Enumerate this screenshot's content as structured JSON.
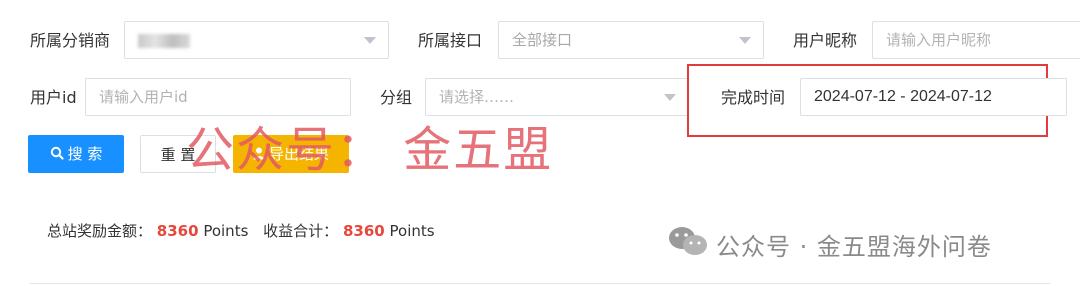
{
  "filters": {
    "distributor": {
      "label": "所属分销商",
      "value": ""
    },
    "interface": {
      "label": "所属接口",
      "value": "全部接口"
    },
    "nickname": {
      "label": "用户昵称",
      "placeholder": "请输入用户昵称"
    },
    "user_id": {
      "label": "用户id",
      "placeholder": "请输入用户id"
    },
    "group": {
      "label": "分组",
      "placeholder": "请选择……"
    },
    "finish_time": {
      "label": "完成时间",
      "value": "2024-07-12 - 2024-07-12"
    }
  },
  "actions": {
    "search": "搜 索",
    "reset": "重 置",
    "export": "导出结果"
  },
  "stats": {
    "total_reward_label": "总站奖励金额：",
    "total_reward_value": "8360",
    "total_reward_unit": "Points",
    "income_label": "收益合计：",
    "income_value": "8360",
    "income_unit": "Points"
  },
  "watermark": {
    "main": "公众号： 金五盟",
    "footer": "公众号 · 金五盟海外问卷"
  },
  "colors": {
    "primary": "#1890ff",
    "export": "#f5b400",
    "highlight": "#e8473b",
    "annotation_box": "#e23b3b",
    "watermark": "#e25a63"
  }
}
